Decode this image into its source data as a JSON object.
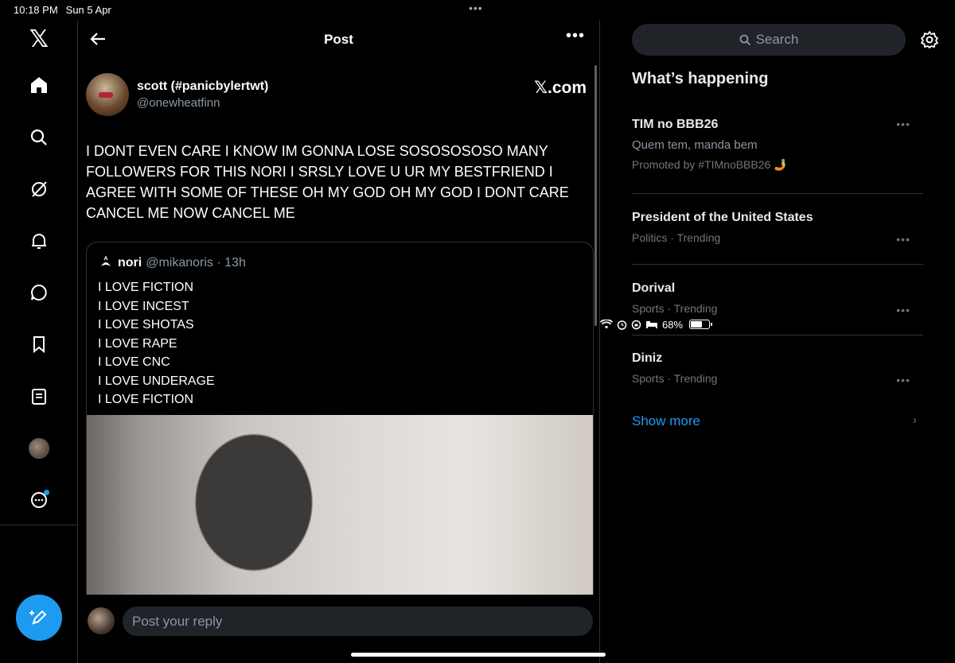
{
  "status": {
    "time": "10:18 PM",
    "date": "Sun 5 Apr",
    "multitask": "•••",
    "battery_percent": "68%",
    "battery_level": 0.68
  },
  "nav": {
    "logo": "𝕏",
    "items": [
      "home-icon",
      "search-icon",
      "grok-icon",
      "notifications-icon",
      "messages-icon",
      "bookmarks-icon",
      "lists-icon",
      "profile-avatar",
      "more-icon"
    ]
  },
  "post": {
    "header_title": "Post",
    "more": "•••",
    "author_name": "scott (#panicbylertwt)",
    "author_handle": "@onewheatfinn",
    "brand": "𝕏.com",
    "text": "I DONT EVEN CARE I KNOW IM GONNA LOSE SOSOSOSOSO MANY FOLLOWERS FOR THIS NORI I SRSLY LOVE U UR MY BESTFRIEND I AGREE WITH SOME OF THESE OH MY GOD OH MY GOD I DONT CARE CANCEL ME NOW CANCEL ME",
    "quote": {
      "name": "nori",
      "handle_time": "@mikanoris · 13h",
      "lines": [
        "I LOVE FICTION",
        "I LOVE INCEST",
        "I LOVE SHOTAS",
        "I LOVE RAPE",
        "I LOVE CNC",
        "I LOVE UNDERAGE",
        "I LOVE FICTION"
      ]
    },
    "reply_placeholder": "Post your reply"
  },
  "sidebar": {
    "search_placeholder": "Search",
    "section_title": "What’s happening",
    "trends": [
      {
        "name": "TIM no BBB26",
        "sub": "Quem tem, manda bem",
        "meta": "Promoted by #TIMnoBBB26 🤳"
      },
      {
        "name": "President of the United States",
        "meta": "Politics · Trending"
      },
      {
        "name": "Dorival",
        "meta": "Sports · Trending"
      },
      {
        "name": "Diniz",
        "meta": "Sports · Trending"
      }
    ],
    "dots": "•••",
    "show_more": "Show more",
    "chevron": "›"
  }
}
